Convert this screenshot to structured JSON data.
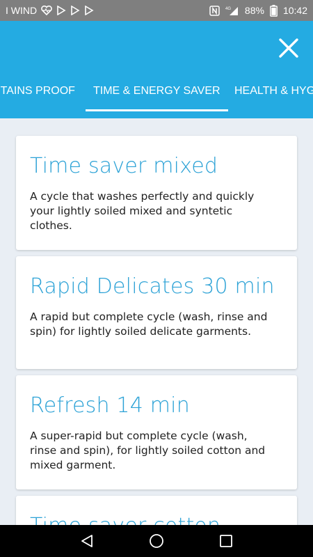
{
  "status_bar": {
    "carrier": "I WIND",
    "battery": "88%",
    "time": "10:42",
    "network": "4G"
  },
  "header": {
    "close_icon": "close-icon",
    "tabs": [
      {
        "label": "STAINS PROOF"
      },
      {
        "label": "TIME & ENERGY SAVER"
      },
      {
        "label": "HEALTH & HYG"
      }
    ],
    "active_tab_index": 1
  },
  "cards": [
    {
      "title": "Time saver mixed",
      "description": "A cycle that washes perfectly and quickly your lightly soiled mixed and syntetic clothes."
    },
    {
      "title": "Rapid Delicates 30 min",
      "description": "A rapid but complete cycle (wash, rinse and spin) for lightly soiled delicate garments."
    },
    {
      "title": "Refresh 14 min",
      "description": "A super-rapid but complete cycle (wash, rinse and spin), for lightly soiled cotton and mixed garment."
    },
    {
      "title": "Time saver cotton",
      "description": ""
    }
  ],
  "colors": {
    "accent": "#24abe2",
    "title_text": "#2ca2d6",
    "background": "#e9eef4",
    "status_bar": "#7f7f7f"
  },
  "nav_bar": {
    "back_icon": "back-triangle-icon",
    "home_icon": "home-circle-icon",
    "recents_icon": "recents-square-icon"
  }
}
